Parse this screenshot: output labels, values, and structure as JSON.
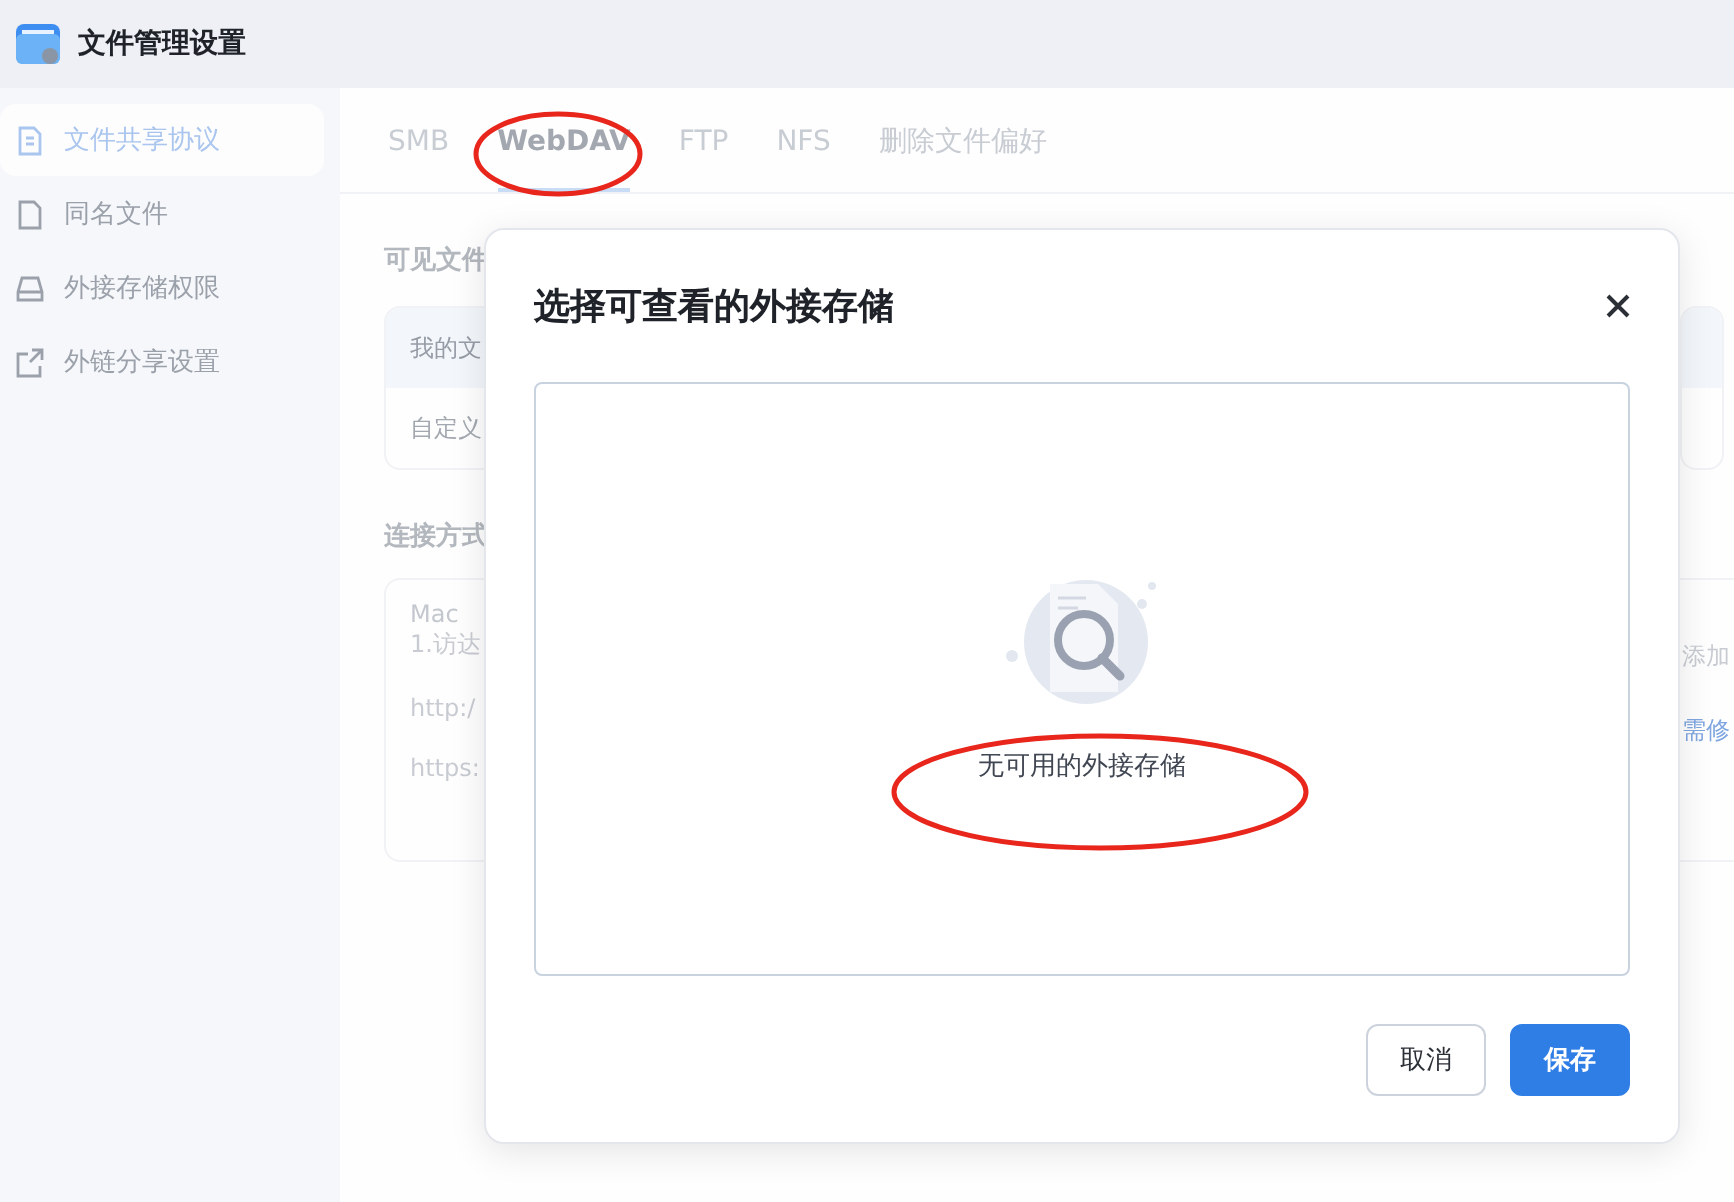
{
  "window": {
    "title": "文件管理设置"
  },
  "sidebar": {
    "items": [
      {
        "label": "文件共享协议",
        "selected": true
      },
      {
        "label": "同名文件",
        "selected": false
      },
      {
        "label": "外接存储权限",
        "selected": false
      },
      {
        "label": "外链分享设置",
        "selected": false
      }
    ]
  },
  "tabs": [
    {
      "label": "SMB",
      "selected": false
    },
    {
      "label": "WebDAV",
      "selected": true
    },
    {
      "label": "FTP",
      "selected": false
    },
    {
      "label": "NFS",
      "selected": false
    },
    {
      "label": "删除文件偏好",
      "selected": false
    }
  ],
  "content": {
    "section_1_title": "可见文件",
    "table_header": "我的文",
    "table_row": "自定义",
    "section_2_title": "连接方式",
    "connection_card": {
      "platform": "Mac",
      "step": "1.访达",
      "http_line": "http:/",
      "https_line": "https:",
      "right_text": "添加",
      "right_link": "需修"
    }
  },
  "dialog": {
    "title": "选择可查看的外接存储",
    "empty_message": "无可用的外接存储",
    "buttons": [
      {
        "label": "取消",
        "kind": "secondary"
      },
      {
        "label": "保存",
        "kind": "primary"
      }
    ]
  }
}
